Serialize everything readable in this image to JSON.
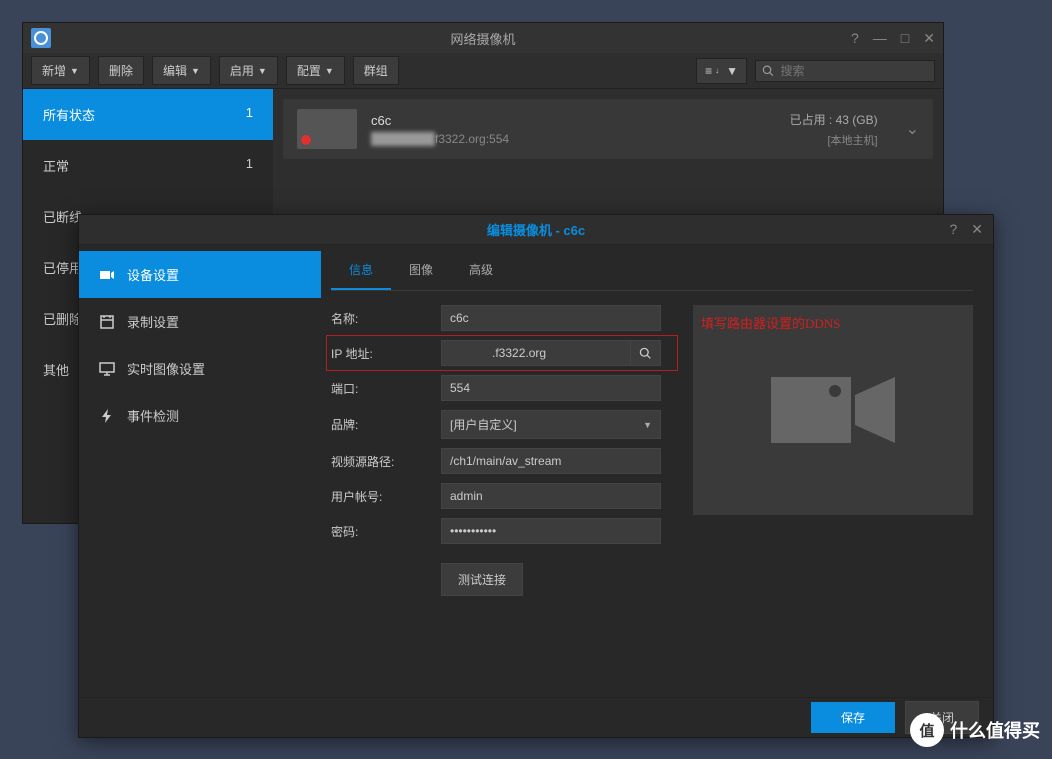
{
  "main": {
    "title": "网络摄像机",
    "toolbar": {
      "add": "新增",
      "delete": "删除",
      "edit": "编辑",
      "enable": "启用",
      "config": "配置",
      "group": "群组"
    },
    "search_placeholder": "搜索",
    "statuses": [
      {
        "label": "所有状态",
        "count": "1"
      },
      {
        "label": "正常",
        "count": "1"
      },
      {
        "label": "已断线",
        "count": ""
      },
      {
        "label": "已停用",
        "count": ""
      },
      {
        "label": "已删除",
        "count": ""
      },
      {
        "label": "其他",
        "count": ""
      }
    ],
    "camera": {
      "name": "c6c",
      "addr_suffix": "f3322.org:554",
      "usage": "已占用 :  43 (GB)",
      "host": "[本地主机]"
    }
  },
  "dialog": {
    "title": "编辑摄像机 - c6c",
    "side": {
      "device": "设备设置",
      "record": "录制设置",
      "live": "实时图像设置",
      "event": "事件检测"
    },
    "tabs": {
      "info": "信息",
      "image": "图像",
      "advanced": "高级"
    },
    "form": {
      "name_label": "名称:",
      "name_value": "c6c",
      "ip_label": "IP 地址:",
      "ip_value_suffix": ".f3322.org",
      "port_label": "端口:",
      "port_value": "554",
      "brand_label": "品牌:",
      "brand_value": "[用户自定义]",
      "path_label": "视频源路径:",
      "path_value": "/ch1/main/av_stream",
      "user_label": "用户帐号:",
      "user_value": "admin",
      "pass_label": "密码:",
      "pass_value": "•••••••••••",
      "test": "测试连接"
    },
    "annotation": "填写路由器设置的DDNS",
    "footer": {
      "save": "保存",
      "close": "关闭"
    }
  },
  "watermark": "什么值得买"
}
